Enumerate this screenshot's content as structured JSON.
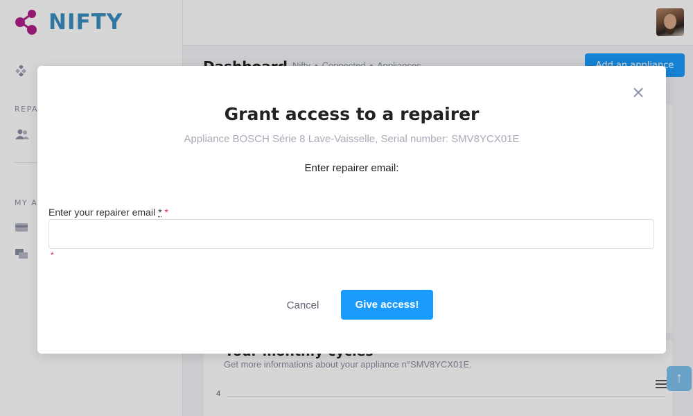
{
  "app": {
    "brand": "NIFTY"
  },
  "sidebar": {
    "sections": [
      {
        "label": "REPA"
      },
      {
        "label": "MY A"
      }
    ],
    "icons": [
      "dashboard-icon",
      "users-icon",
      "credit-card-icon",
      "chat-icon"
    ]
  },
  "header": {
    "title": "Dashboard",
    "breadcrumbs": [
      "Nifty",
      "Connected",
      "Appliances"
    ],
    "breadcrumb_separator": "•",
    "add_button_label": "Add an appliance"
  },
  "background_card": {
    "title": "Your monthly cycles",
    "subtitle": "Get more informations about your appliance n°SMV8YCX01E.",
    "y_tick": "4"
  },
  "modal": {
    "title": "Grant access to a repairer",
    "subtitle": "Appliance BOSCH Série 8 Lave-Vaisselle, Serial number: SMV8YCX01E",
    "prompt": "Enter repairer email:",
    "field_label": "Enter your repairer email",
    "field_marker": "*",
    "required_marker": "*",
    "field_value": "",
    "field_placeholder": "",
    "error_marker": "*",
    "cancel_label": "Cancel",
    "submit_label": "Give access!",
    "close_glyph": "×"
  },
  "scroll_top_glyph": "↑",
  "colors": {
    "accent": "#1a9bfc",
    "logo_magenta": "#b01f8a",
    "logo_text": "#3a8fc0",
    "required": "#e0245e"
  }
}
